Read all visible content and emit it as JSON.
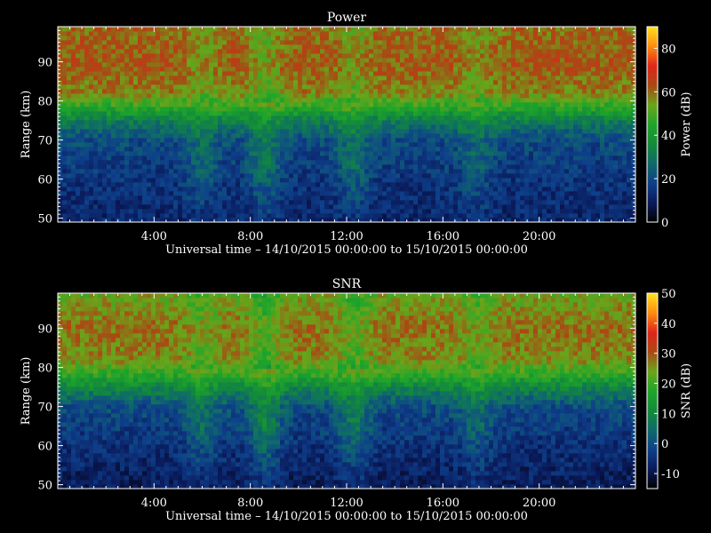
{
  "figure": {
    "background": "#000000",
    "foreground": "#ffffff"
  },
  "chart_data": [
    {
      "type": "heatmap",
      "title": "Power",
      "xlabel": "Universal time – 14/10/2015 00:00:00 to 15/10/2015 00:00:00",
      "ylabel": "Range (km)",
      "x_ticks": [
        "4:00",
        "8:00",
        "12:00",
        "16:00",
        "20:00"
      ],
      "x_tick_hours": [
        4,
        8,
        12,
        16,
        20
      ],
      "xlim_hours": [
        0,
        24
      ],
      "y_ticks": [
        50,
        60,
        70,
        80,
        90
      ],
      "ylim": [
        49,
        99
      ],
      "colorbar": {
        "label": "Power (dB)",
        "range": [
          0,
          90
        ],
        "ticks": [
          0,
          20,
          40,
          60,
          80
        ],
        "colormap": [
          "#000000",
          "#0a1a5a",
          "#0e3f8a",
          "#0f6a6a",
          "#138a3a",
          "#1ea52a",
          "#6aa51a",
          "#a84a14",
          "#e0241a",
          "#ff8a10",
          "#ffe020"
        ]
      },
      "profile_db": {
        "range_km": [
          50,
          60,
          70,
          75,
          78,
          82,
          90,
          98
        ],
        "db": [
          12,
          15,
          20,
          32,
          44,
          58,
          62,
          60
        ]
      },
      "fluctuations": [
        {
          "hour": 6.0,
          "amp_db": 10
        },
        {
          "hour": 8.6,
          "amp_db": 14
        },
        {
          "hour": 12.3,
          "amp_db": 12
        },
        {
          "hour": 17.4,
          "amp_db": 9
        }
      ]
    },
    {
      "type": "heatmap",
      "title": "SNR",
      "xlabel": "Universal time – 14/10/2015 00:00:00 to 15/10/2015 00:00:00",
      "ylabel": "Range (km)",
      "x_ticks": [
        "4:00",
        "8:00",
        "12:00",
        "16:00",
        "20:00"
      ],
      "x_tick_hours": [
        4,
        8,
        12,
        16,
        20
      ],
      "xlim_hours": [
        0,
        24
      ],
      "y_ticks": [
        50,
        60,
        70,
        80,
        90
      ],
      "ylim": [
        49,
        99
      ],
      "colorbar": {
        "label": "SNR (dB)",
        "range": [
          -15,
          50
        ],
        "ticks": [
          -10,
          0,
          10,
          20,
          30,
          40,
          50
        ],
        "colormap": [
          "#000000",
          "#0a1a5a",
          "#0e3f8a",
          "#0f6a6a",
          "#138a3a",
          "#1ea52a",
          "#6aa51a",
          "#a84a14",
          "#e0241a",
          "#ff8a10",
          "#ffe020"
        ]
      },
      "profile_db": {
        "range_km": [
          50,
          60,
          70,
          75,
          78,
          82,
          90,
          98
        ],
        "db": [
          -8,
          -5,
          0,
          10,
          18,
          26,
          28,
          24
        ]
      },
      "fluctuations": [
        {
          "hour": 6.0,
          "amp_db": 8
        },
        {
          "hour": 8.6,
          "amp_db": 12
        },
        {
          "hour": 12.3,
          "amp_db": 10
        },
        {
          "hour": 17.4,
          "amp_db": 7
        }
      ]
    }
  ]
}
